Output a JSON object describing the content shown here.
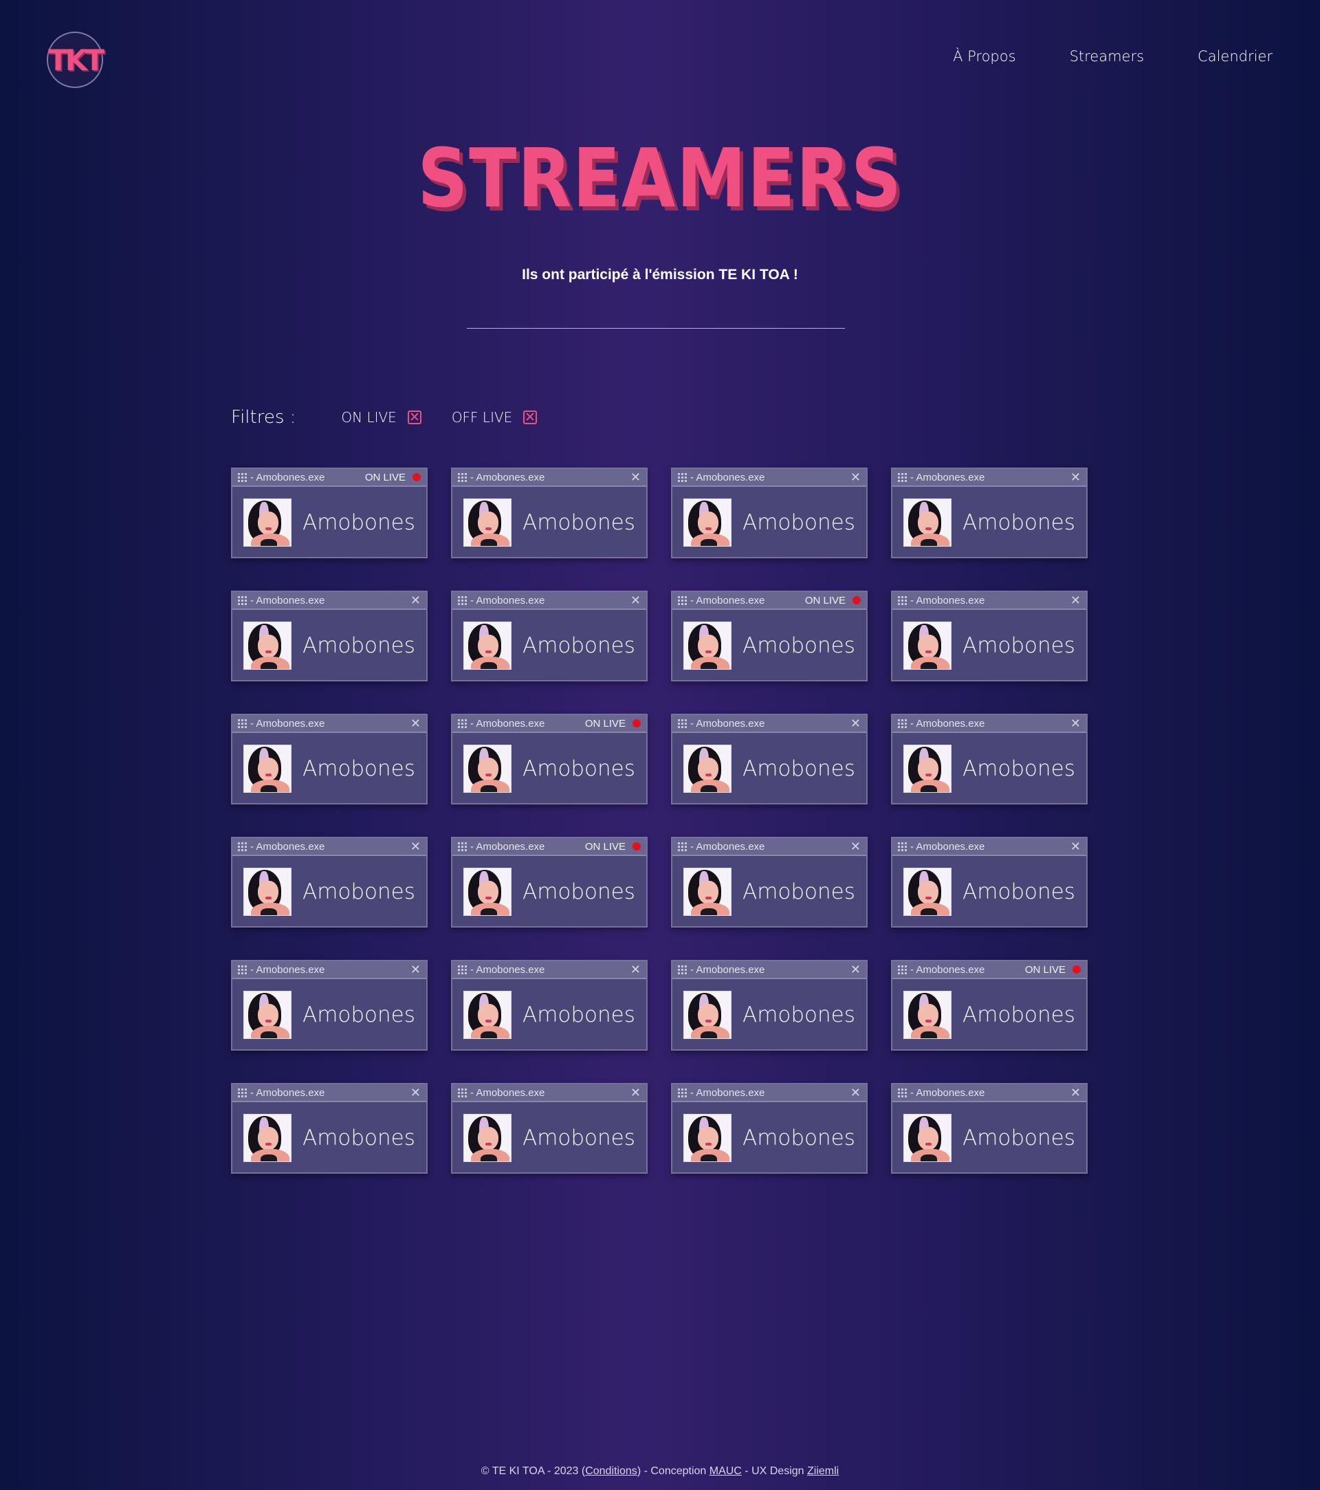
{
  "brand": {
    "logo_text": "TKT",
    "accent": "#ef4f81",
    "accent_shadow": "#9d2c58"
  },
  "nav": {
    "items": [
      "À Propos",
      "Streamers",
      "Calendrier"
    ]
  },
  "page": {
    "title": "STREAMERS",
    "subtitle": "Ils ont participé à l'émission TE KI TOA !"
  },
  "filters": {
    "label": "Filtres :",
    "options": [
      {
        "label": "ON LIVE",
        "checked": true
      },
      {
        "label": "OFF LIVE",
        "checked": true
      }
    ]
  },
  "live_label": "ON LIVE",
  "live_dot_color": "#e0121f",
  "streamers": [
    {
      "window": "- Amobones.exe",
      "name": "Amobones",
      "live": true
    },
    {
      "window": "- Amobones.exe",
      "name": "Amobones",
      "live": false
    },
    {
      "window": "- Amobones.exe",
      "name": "Amobones",
      "live": false
    },
    {
      "window": "- Amobones.exe",
      "name": "Amobones",
      "live": false
    },
    {
      "window": "- Amobones.exe",
      "name": "Amobones",
      "live": false
    },
    {
      "window": "- Amobones.exe",
      "name": "Amobones",
      "live": false
    },
    {
      "window": "- Amobones.exe",
      "name": "Amobones",
      "live": true
    },
    {
      "window": "- Amobones.exe",
      "name": "Amobones",
      "live": false
    },
    {
      "window": "- Amobones.exe",
      "name": "Amobones",
      "live": false
    },
    {
      "window": "- Amobones.exe",
      "name": "Amobones",
      "live": true
    },
    {
      "window": "- Amobones.exe",
      "name": "Amobones",
      "live": false
    },
    {
      "window": "- Amobones.exe",
      "name": "Amobones",
      "live": false
    },
    {
      "window": "- Amobones.exe",
      "name": "Amobones",
      "live": false
    },
    {
      "window": "- Amobones.exe",
      "name": "Amobones",
      "live": true
    },
    {
      "window": "- Amobones.exe",
      "name": "Amobones",
      "live": false
    },
    {
      "window": "- Amobones.exe",
      "name": "Amobones",
      "live": false
    },
    {
      "window": "- Amobones.exe",
      "name": "Amobones",
      "live": false
    },
    {
      "window": "- Amobones.exe",
      "name": "Amobones",
      "live": false
    },
    {
      "window": "- Amobones.exe",
      "name": "Amobones",
      "live": false
    },
    {
      "window": "- Amobones.exe",
      "name": "Amobones",
      "live": true
    },
    {
      "window": "- Amobones.exe",
      "name": "Amobones",
      "live": false
    },
    {
      "window": "- Amobones.exe",
      "name": "Amobones",
      "live": false
    },
    {
      "window": "- Amobones.exe",
      "name": "Amobones",
      "live": false
    },
    {
      "window": "- Amobones.exe",
      "name": "Amobones",
      "live": false
    }
  ],
  "footer": {
    "prefix": "© TE KI TOA - 2023 (",
    "conditions": "Conditions",
    "mid": ") - Conception ",
    "conception": "MAUC",
    "mid2": " - UX Design ",
    "design": "Ziiemli"
  }
}
